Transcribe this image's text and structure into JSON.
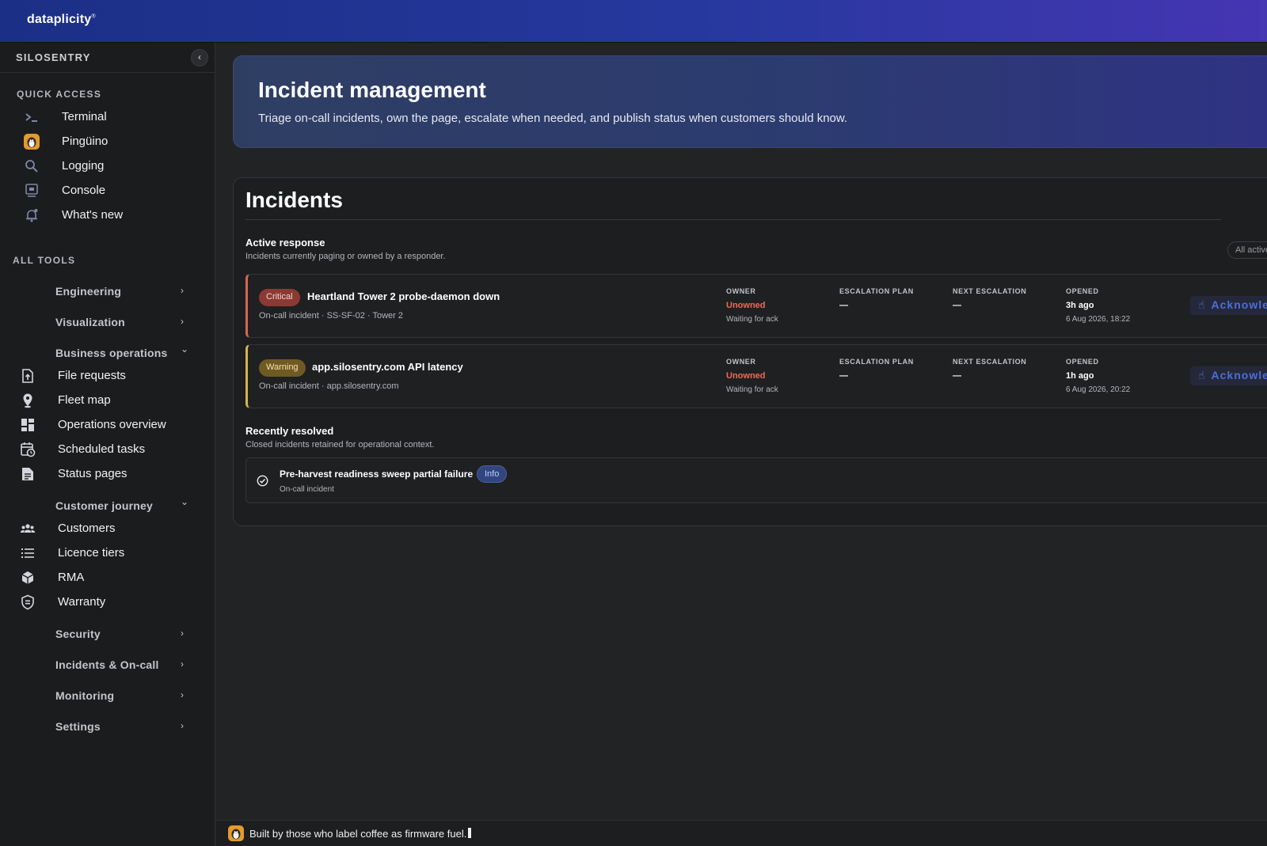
{
  "brand": {
    "name": "dataplicity",
    "mark": "®"
  },
  "sidebar": {
    "org_name": "SILOSENTRY",
    "collapse_glyph": "‹",
    "quick_access_label": "QUICK ACCESS",
    "quick_access": [
      {
        "label": "Terminal",
        "icon": "terminal-icon"
      },
      {
        "label": "Pingüino",
        "icon": "penguin-icon"
      },
      {
        "label": "Logging",
        "icon": "search-icon"
      },
      {
        "label": "Console",
        "icon": "console-icon"
      },
      {
        "label": "What's new",
        "icon": "bell-icon"
      }
    ],
    "all_tools_label": "ALL TOOLS",
    "groups": {
      "engineering": "Engineering",
      "visualization": "Visualization",
      "business_operations": "Business operations",
      "customer_journey": "Customer journey",
      "security": "Security",
      "incidents_oncall": "Incidents & On-call",
      "monitoring": "Monitoring",
      "settings": "Settings"
    },
    "business_tools": [
      {
        "label": "File requests",
        "icon": "file-upload-icon"
      },
      {
        "label": "Fleet map",
        "icon": "map-pin-icon"
      },
      {
        "label": "Operations overview",
        "icon": "dashboard-icon"
      },
      {
        "label": "Scheduled tasks",
        "icon": "calendar-clock-icon"
      },
      {
        "label": "Status pages",
        "icon": "document-icon"
      }
    ],
    "customer_tools": [
      {
        "label": "Customers",
        "icon": "users-icon"
      },
      {
        "label": "Licence tiers",
        "icon": "list-icon"
      },
      {
        "label": "RMA",
        "icon": "box-icon"
      },
      {
        "label": "Warranty",
        "icon": "shield-icon"
      }
    ],
    "chevron_right": "›",
    "chevron_down": "⌄"
  },
  "hero": {
    "title": "Incident management",
    "subtitle": "Triage on-call incidents, own the page, escalate when needed, and publish status when customers should know."
  },
  "panel": {
    "title": "Incidents",
    "active": {
      "title": "Active response",
      "description": "Incidents currently paging or owned by a responder.",
      "filter_label": "All active"
    },
    "columns": {
      "owner": "OWNER",
      "escalation_plan": "ESCALATION PLAN",
      "next_escalation": "NEXT ESCALATION",
      "opened": "OPENED"
    },
    "incidents": [
      {
        "severity": "Critical",
        "title": "Heartland Tower 2 probe-daemon down",
        "meta": "On-call incident · SS-SF-02 · Tower 2",
        "owner": "Unowned",
        "owner_sub": "Waiting for ack",
        "escalation_plan": "—",
        "next_escalation": "—",
        "opened": "3h ago",
        "opened_sub": "6 Aug 2026, 18:22",
        "action": "Acknowledge"
      },
      {
        "severity": "Warning",
        "title": "app.silosentry.com API latency",
        "meta": "On-call incident · app.silosentry.com",
        "owner": "Unowned",
        "owner_sub": "Waiting for ack",
        "escalation_plan": "—",
        "next_escalation": "—",
        "opened": "1h ago",
        "opened_sub": "6 Aug 2026, 20:22",
        "action": "Acknowledge"
      }
    ],
    "resolved": {
      "title": "Recently resolved",
      "description": "Closed incidents retained for operational context.",
      "items": [
        {
          "title": "Pre-harvest readiness sweep partial failure",
          "badge": "Info",
          "meta": "On-call incident"
        }
      ]
    }
  },
  "footer": {
    "text": "Built by those who label coffee as firmware fuel."
  },
  "colors": {
    "critical": "#d5674f",
    "warning": "#d6b54e",
    "info": "#31467e",
    "accent": "#4a6fd8",
    "owner_red": "#ee6b56"
  }
}
